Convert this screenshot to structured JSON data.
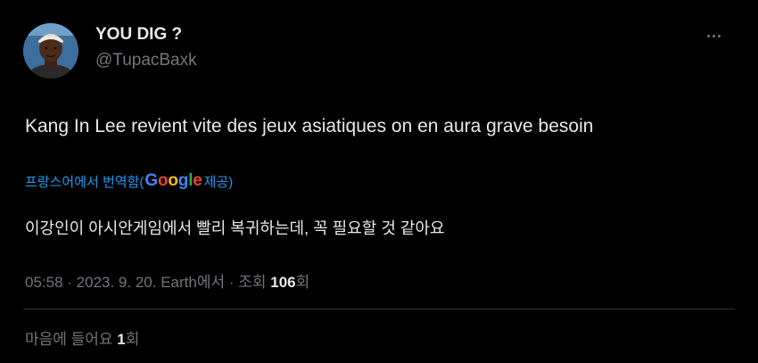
{
  "author": {
    "display_name": "YOU DIG ?",
    "handle": "@TupacBaxk",
    "avatar_icon": "profile-photo"
  },
  "more_icon": "more-horizontal-icon",
  "tweet": {
    "text": "Kang In Lee revient vite des jeux asiatiques on en aura grave besoin"
  },
  "translation": {
    "label": "프랑스어에서 번역함(",
    "google_letters": [
      "G",
      "o",
      "o",
      "g",
      "l",
      "e"
    ],
    "provided": " 제공)",
    "text": "이강인이 아시안게임에서 빨리 복귀하는데, 꼭 필요할 것 같아요"
  },
  "meta": {
    "time": "05:58",
    "sep1": " · ",
    "date": "2023. 9. 20.",
    "location": " Earth에서",
    "sep2": " · ",
    "views_label": "조회 ",
    "views_count": "106",
    "views_suffix": "회"
  },
  "likes": {
    "label": "마음에 들어요 ",
    "count": "1",
    "suffix": "회"
  },
  "colors": {
    "background": "#000000",
    "text": "#e7e9ea",
    "secondary": "#71767b",
    "link": "#1d9bf0",
    "divider": "#2f3336"
  }
}
